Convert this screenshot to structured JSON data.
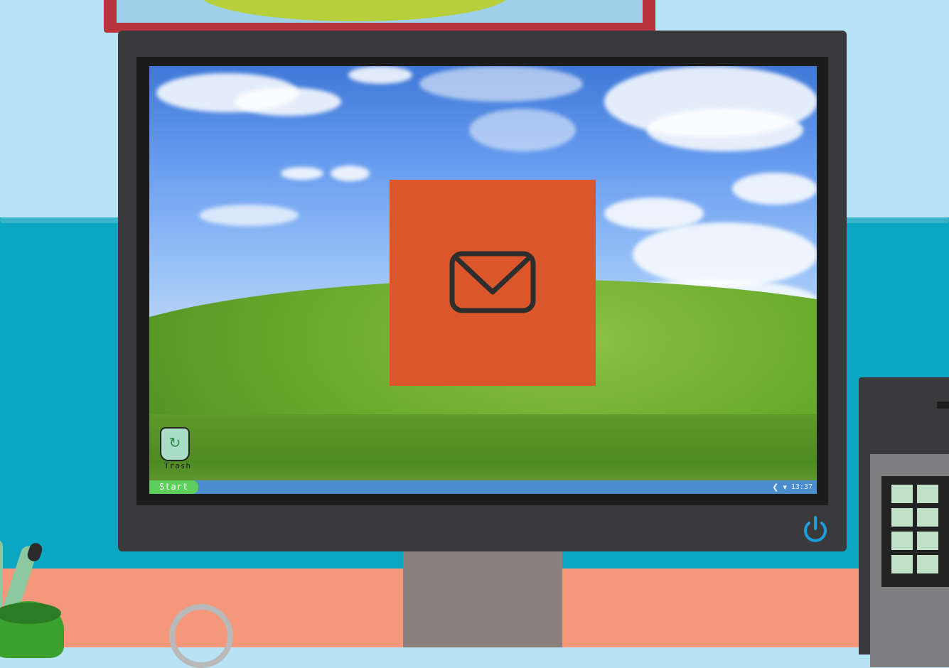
{
  "desktop": {
    "icons": [
      {
        "label": "Trash",
        "icon": "recycle-bin-icon"
      }
    ],
    "open_app": {
      "icon": "mail-envelope-icon",
      "color": "#db562b"
    }
  },
  "taskbar": {
    "start_label": "Start",
    "tray": {
      "volume_icon": "speaker-icon",
      "wifi_icon": "wifi-icon",
      "clock": "13:37"
    },
    "color": "#4a8ccc",
    "start_color": "#5ccf5a"
  },
  "monitor": {
    "power_icon": "power-icon",
    "power_color": "#1e9ed8"
  }
}
